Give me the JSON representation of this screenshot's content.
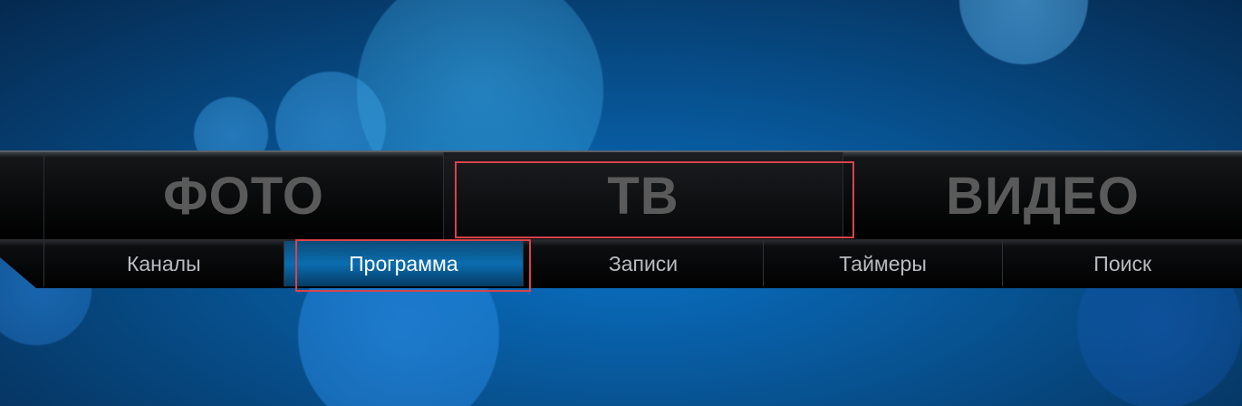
{
  "main_menu": {
    "items": [
      {
        "label": "ФОТО"
      },
      {
        "label": "ТВ"
      },
      {
        "label": "ВИДЕО"
      }
    ],
    "selected": "ТВ"
  },
  "sub_menu": {
    "items": [
      {
        "label": "Каналы"
      },
      {
        "label": "Программа"
      },
      {
        "label": "Записи"
      },
      {
        "label": "Таймеры"
      },
      {
        "label": "Поиск"
      }
    ],
    "selected": "Программа"
  },
  "colors": {
    "highlight_border": "#d9434a",
    "active_subitem": "#0a6db0",
    "inactive_main_label": "#5a5a5a"
  }
}
